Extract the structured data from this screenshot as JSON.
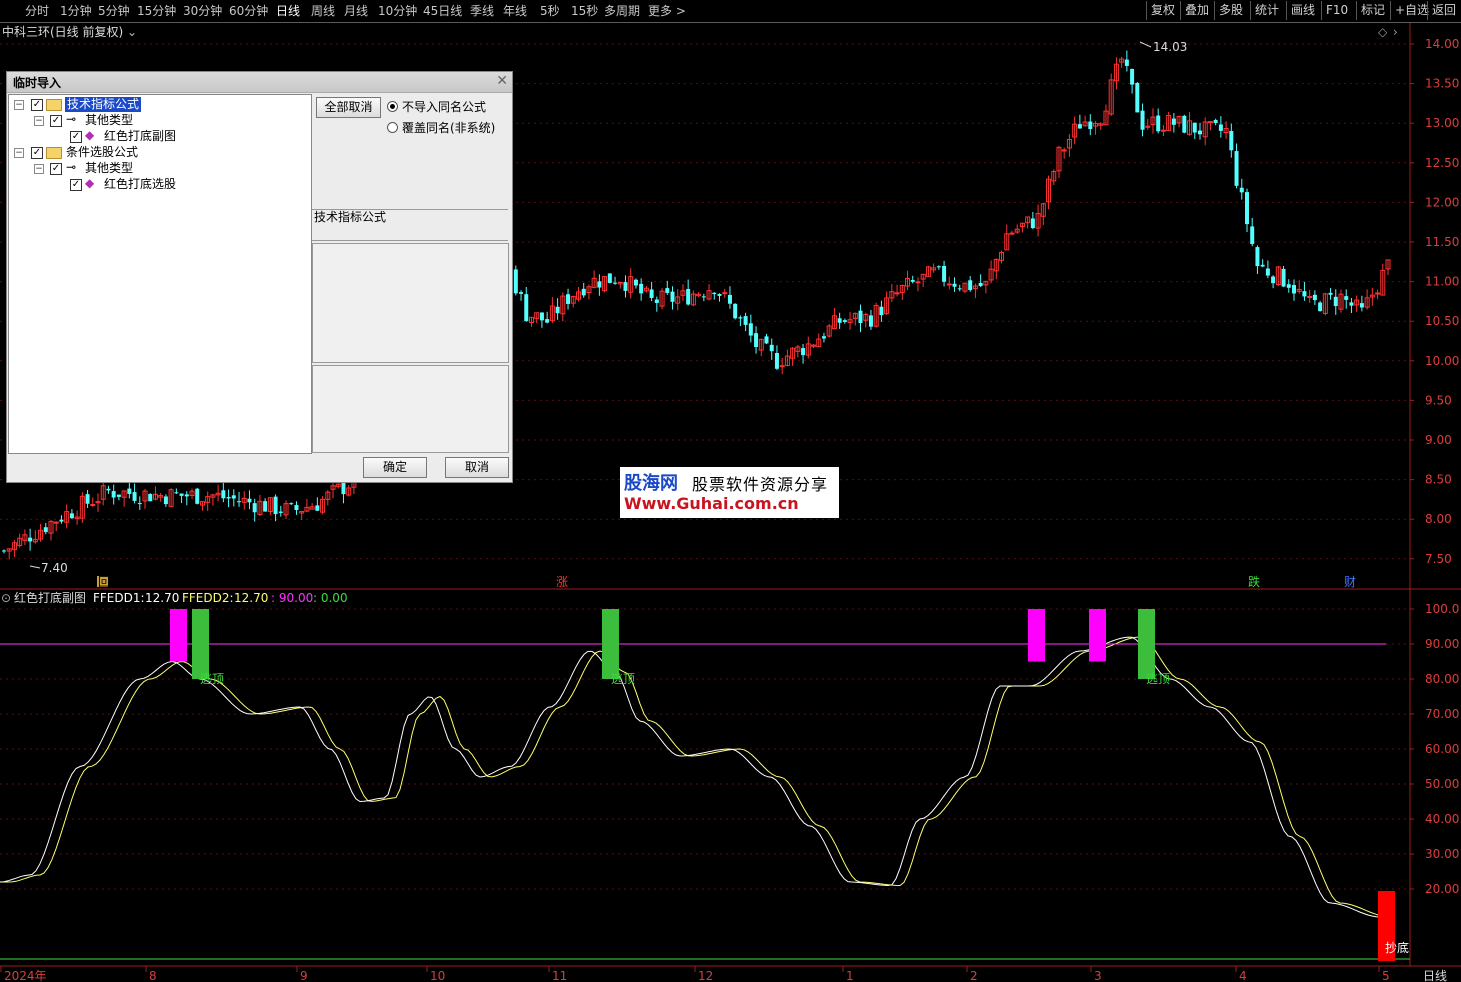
{
  "toolbar": {
    "periods": [
      "分时",
      "1分钟",
      "5分钟",
      "15分钟",
      "30分钟",
      "60分钟",
      "日线",
      "周线",
      "月线",
      "10分钟",
      "45日线",
      "季线",
      "年线",
      "5秒",
      "15秒",
      "多周期",
      "更多 >"
    ],
    "active": "日线",
    "right_buttons": [
      "复权",
      "叠加",
      "多股",
      "统计",
      "画线",
      "F10",
      "标记",
      "+自选",
      "返回"
    ]
  },
  "main_chart": {
    "title": "中科三环(日线 前复权)",
    "price_ticks": [
      "14.00",
      "13.50",
      "13.00",
      "12.50",
      "12.00",
      "11.50",
      "11.00",
      "10.50",
      "10.00",
      "9.50",
      "9.00",
      "8.50",
      "8.00",
      "7.50"
    ],
    "high_label": "14.03",
    "low_label": "7.40",
    "markers": [
      "回",
      "涨",
      "跌",
      "财"
    ]
  },
  "indicator": {
    "name": "红色打底副图",
    "ffedd1_label": "FFEDD1:",
    "ffedd1_value": "12.70",
    "ffedd2_label": "FFEDD2:",
    "ffedd2_value": "12.70",
    "v3": ": 90.00",
    "v4": ": 0.00",
    "ticks": [
      "100.0",
      "90.00",
      "80.00",
      "70.00",
      "60.00",
      "50.00",
      "40.00",
      "30.00",
      "20.00"
    ],
    "top_label": "逃顶",
    "bottom_label": "抄底"
  },
  "x_axis": {
    "labels": [
      "2024年",
      "8",
      "9",
      "10",
      "11",
      "12",
      "1",
      "2",
      "3",
      "4",
      "5"
    ],
    "period": "日线"
  },
  "dialog": {
    "title": "临时导入",
    "tree": [
      {
        "label": "技术指标公式",
        "selected": true
      },
      {
        "label": "其他类型"
      },
      {
        "label": "红色打底副图"
      },
      {
        "label": "条件选股公式"
      },
      {
        "label": "其他类型"
      },
      {
        "label": "红色打底选股"
      }
    ],
    "cancel_all": "全部取消",
    "radio1": "不导入同名公式",
    "radio2": "覆盖同名(非系统)",
    "info_label": "技术指标公式",
    "ok": "确定",
    "cancel": "取消"
  },
  "watermark": {
    "brand": "股海网",
    "slogan": "股票软件资源分享",
    "url": "Www.Guhai.com.cn"
  },
  "chart_data": {
    "type": "candlestick",
    "price_range": [
      7.2,
      14.2
    ],
    "indicator_range": [
      0,
      105
    ],
    "reference_line": 90,
    "colors": {
      "up": "#ff3232",
      "down": "#54ffff",
      "line1": "#ffffff",
      "line2": "#ffff6e",
      "ref": "#ff32ff",
      "top_bar": "#ff00ff",
      "sell_bar": "#3cbe3c",
      "bottom_bar": "#ff0000"
    }
  }
}
